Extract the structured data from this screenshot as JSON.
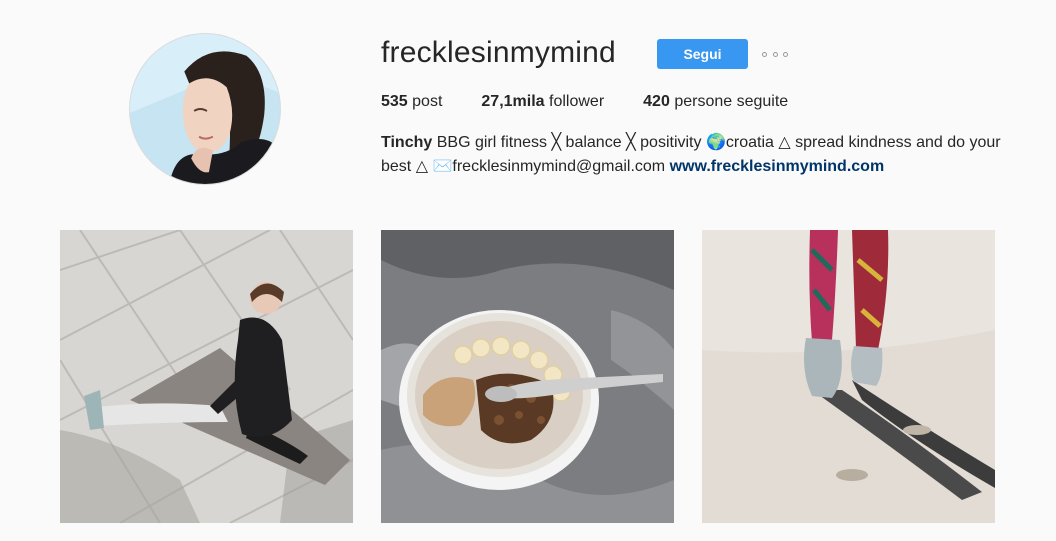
{
  "profile": {
    "username": "frecklesinmymind",
    "follow_label": "Segui",
    "stats": {
      "posts_count": "535",
      "posts_label": "post",
      "followers_count": "27,1mila",
      "followers_label": "follower",
      "following_count": "420",
      "following_label": "persone seguite"
    },
    "bio": {
      "name": "Tinchy",
      "text_1": "BBG girl fitness",
      "sep_1": "╳",
      "text_2": "balance",
      "sep_2": "╳",
      "text_3": "positivity",
      "globe": "🌍",
      "text_4": "croatia",
      "tri_1": "△",
      "text_5": "spread kindness and do your best",
      "tri_2": "△",
      "mail": "✉️",
      "email": "frecklesinmymind@gmail.com",
      "website": "www.frecklesinmymind.com"
    }
  },
  "posts": [
    {
      "subject": "woman stretching on stone pavement"
    },
    {
      "subject": "smoothie bowl on grey linen"
    },
    {
      "subject": "legs walking on sand"
    }
  ],
  "colors": {
    "accent": "#3897f0",
    "link": "#003569",
    "background": "#fafafa",
    "text": "#262626"
  }
}
